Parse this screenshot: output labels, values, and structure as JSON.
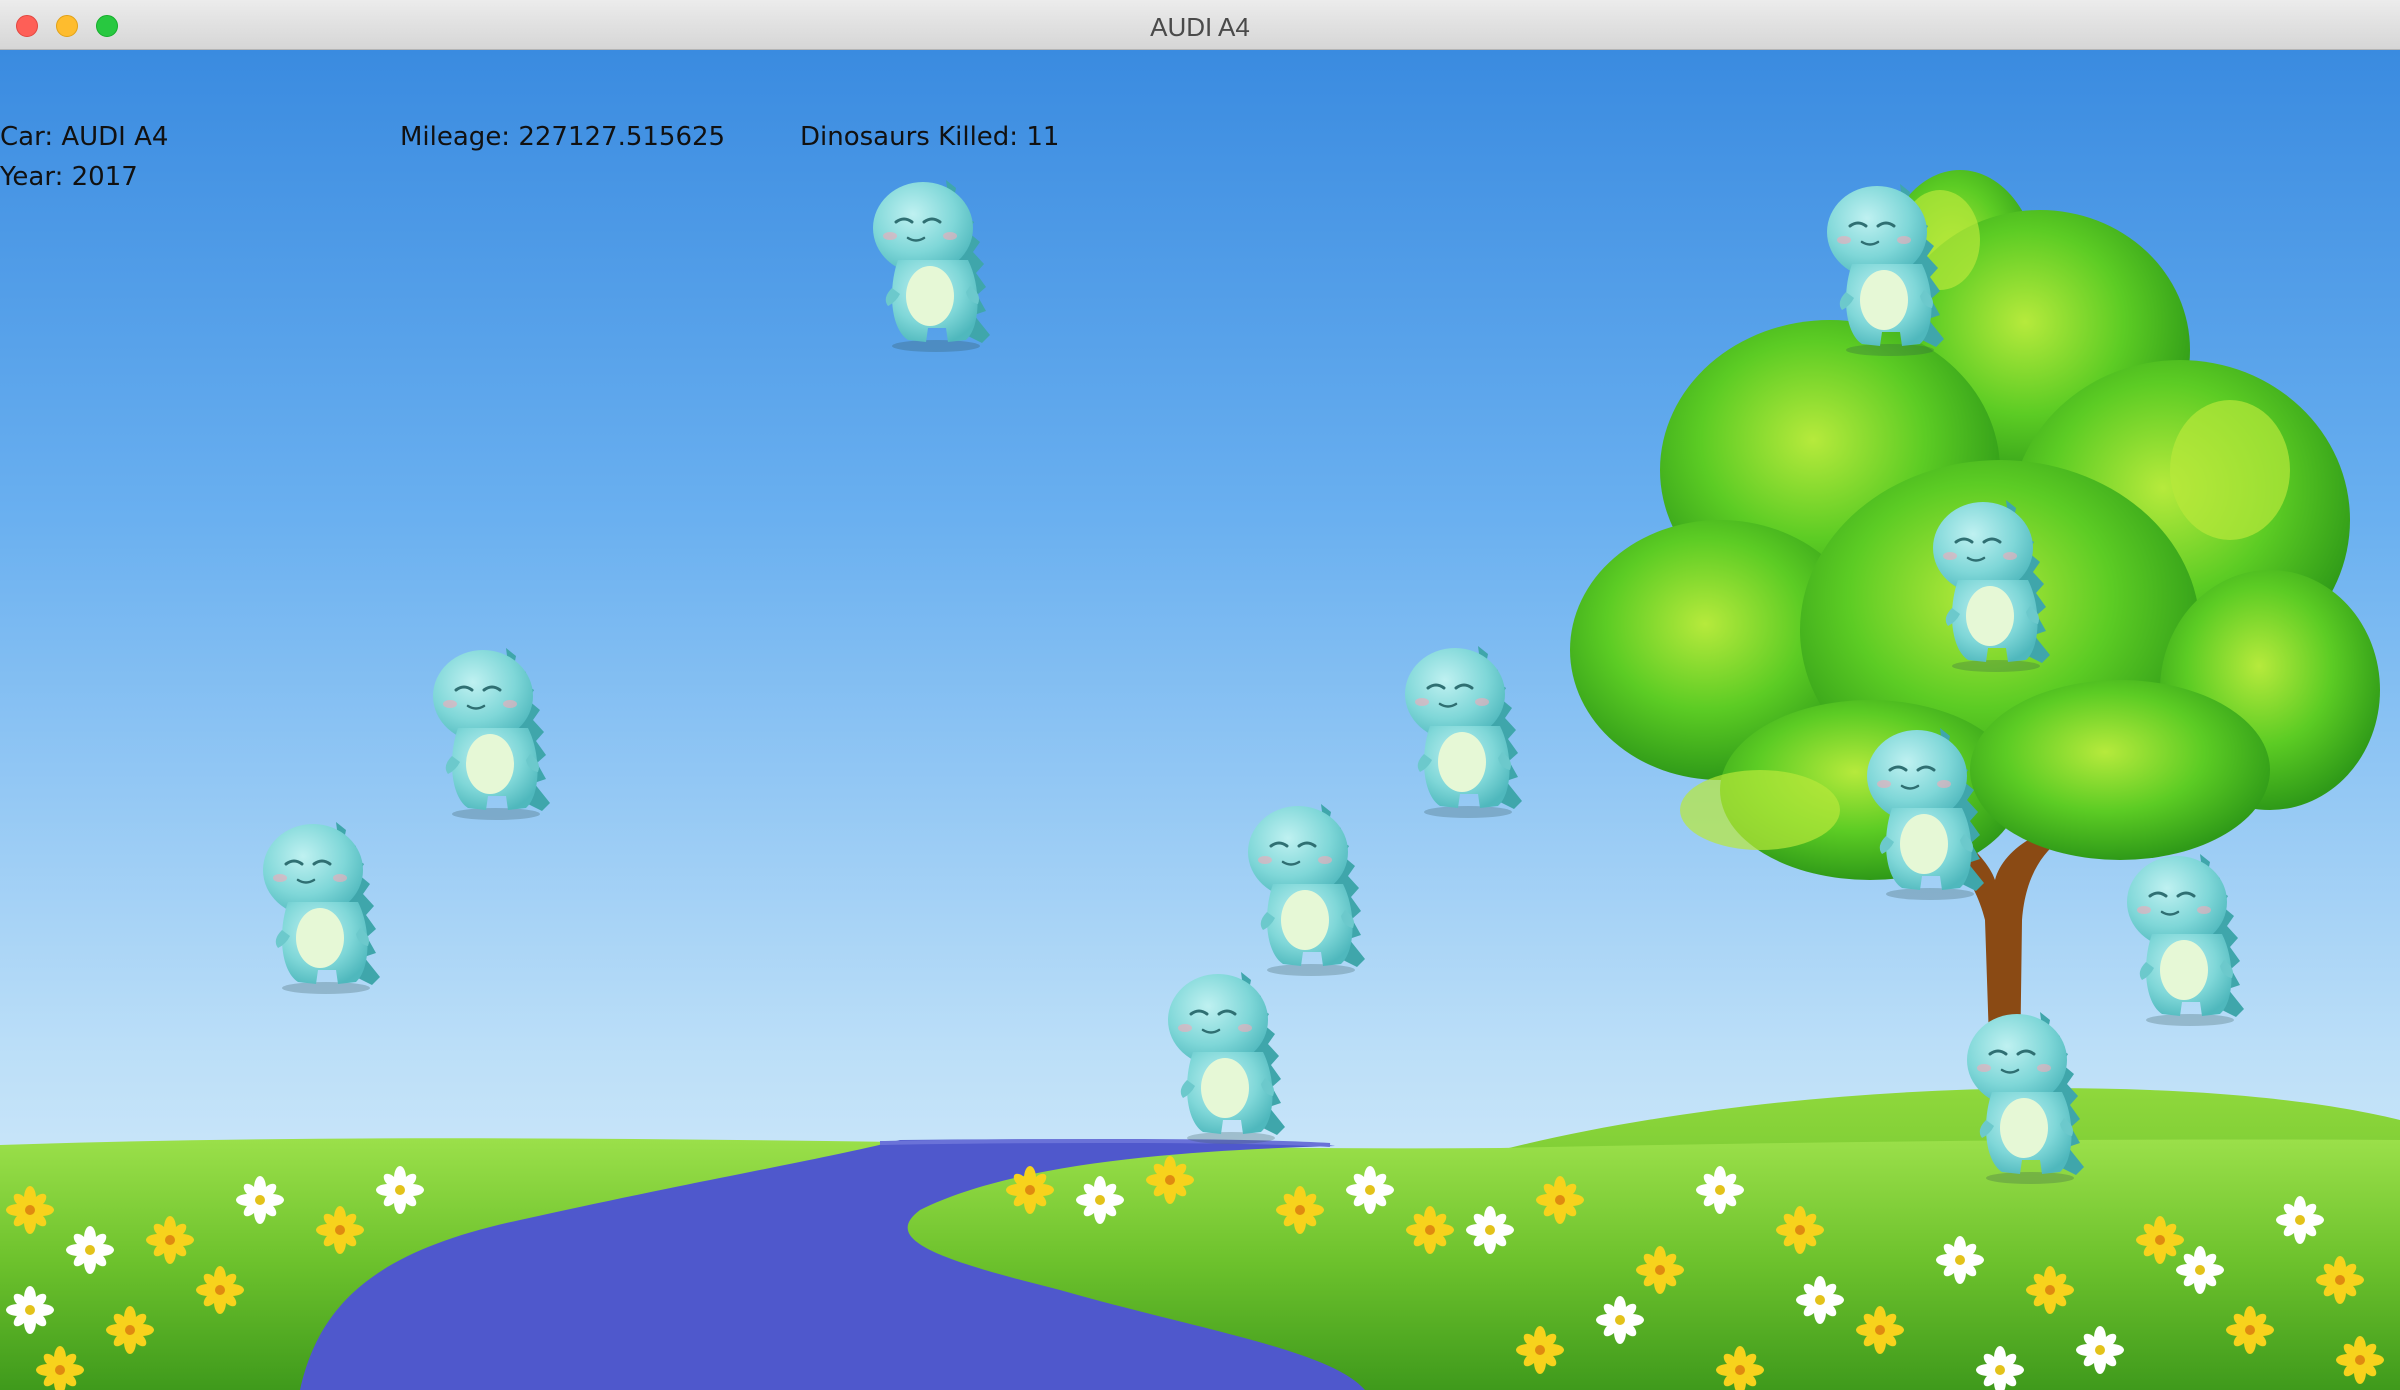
{
  "window": {
    "title": "AUDI A4"
  },
  "hud": {
    "car_label": "Car: AUDI A4",
    "year_label": "Year: 2017",
    "mileage_label": "Mileage: 227127.515625",
    "dinosaurs_label": "Dinosaurs Killed: 11"
  },
  "scene": {
    "sky_top_color": "#3f8fe2",
    "sky_bottom_color": "#d8ecfb",
    "grass_color": "#6cc12c",
    "river_color": "#4f58cc",
    "tree_trunk_color": "#8a4a14",
    "tree_leaf_color": "#4bc21e"
  },
  "dinosaurs": [
    {
      "name": "dinosaur-1"
    },
    {
      "name": "dinosaur-2"
    },
    {
      "name": "dinosaur-3"
    },
    {
      "name": "dinosaur-4"
    },
    {
      "name": "dinosaur-5"
    },
    {
      "name": "dinosaur-6"
    },
    {
      "name": "dinosaur-7"
    },
    {
      "name": "dinosaur-8"
    },
    {
      "name": "dinosaur-9"
    },
    {
      "name": "dinosaur-10"
    },
    {
      "name": "dinosaur-11"
    },
    {
      "name": "dinosaur-12"
    }
  ]
}
